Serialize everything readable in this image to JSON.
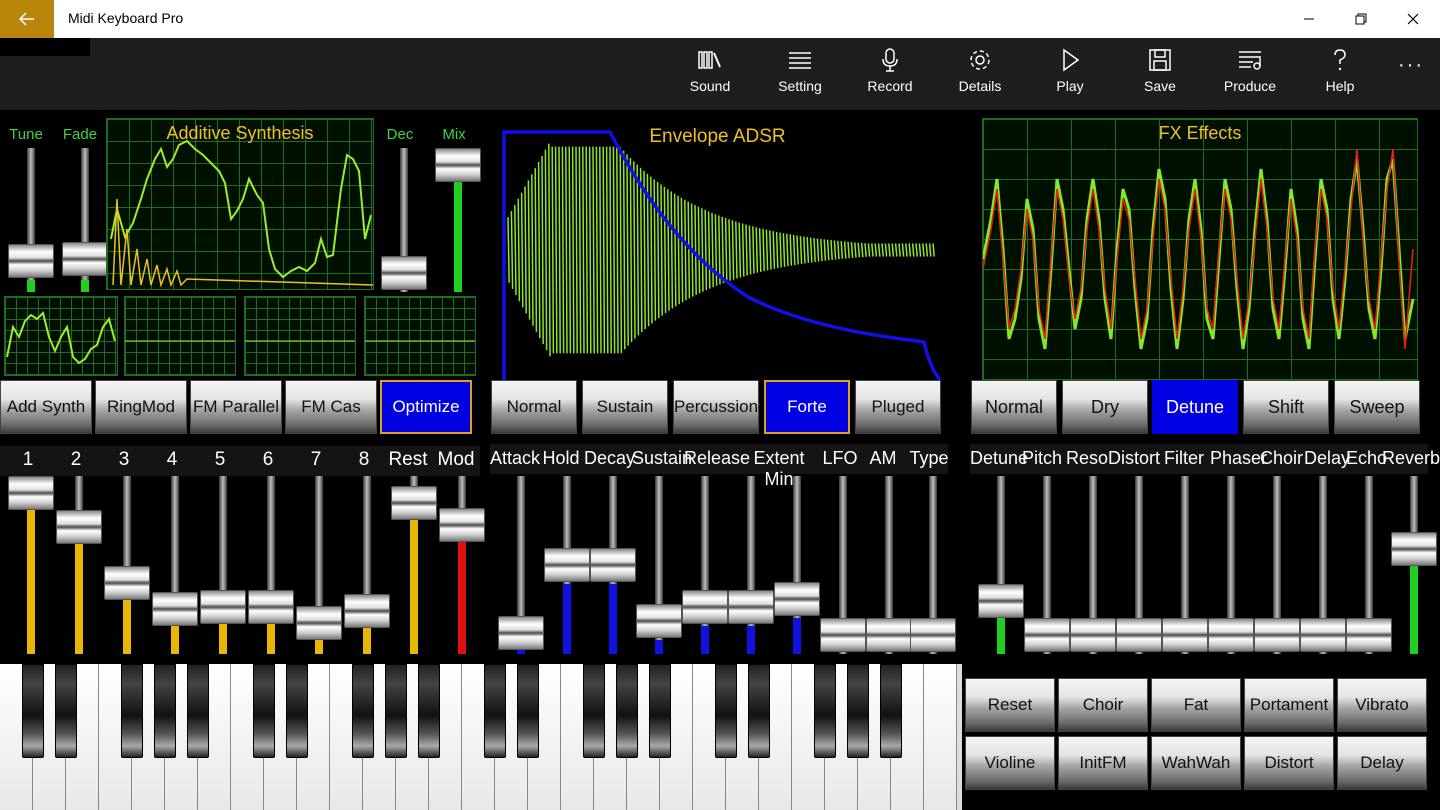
{
  "window": {
    "title": "Midi Keyboard Pro"
  },
  "toolbar": {
    "items": [
      {
        "label": "Sound",
        "icon": "library-icon"
      },
      {
        "label": "Setting",
        "icon": "list-icon"
      },
      {
        "label": "Record",
        "icon": "microphone-icon"
      },
      {
        "label": "Details",
        "icon": "gear-icon"
      },
      {
        "label": "Play",
        "icon": "play-icon"
      },
      {
        "label": "Save",
        "icon": "floppy-icon"
      },
      {
        "label": "Produce",
        "icon": "produce-icon"
      },
      {
        "label": "Help",
        "icon": "question-icon"
      }
    ],
    "more": "···"
  },
  "synthesis": {
    "title": "Additive Synthesis",
    "labels": {
      "tune": "Tune",
      "fade": "Fade",
      "dec": "Dec",
      "mix": "Mix"
    },
    "modes": [
      "Add Synth",
      "RingMod",
      "FM Parallel",
      "FM Cas",
      "Optimize"
    ],
    "selected_mode": "Optimize",
    "slider_labels": [
      "1",
      "2",
      "3",
      "4",
      "5",
      "6",
      "7",
      "8",
      "Rest",
      "Mod"
    ]
  },
  "envelope": {
    "title": "Envelope ADSR",
    "modes": [
      "Normal",
      "Sustain",
      "Percussion",
      "Forte",
      "Pluged"
    ],
    "selected_mode": "Forte",
    "slider_labels": [
      "Attack",
      "Hold",
      "Decay",
      "Sustain",
      "Release",
      "Extent Min",
      "LFO",
      "AM",
      "Type"
    ]
  },
  "fx": {
    "title": "FX Effects",
    "modes": [
      "Normal",
      "Dry",
      "Detune",
      "Shift",
      "Sweep"
    ],
    "selected_mode": "Detune",
    "slider_labels": [
      "Detune",
      "Pitch",
      "Reso",
      "Distort",
      "Filter",
      "Phaser",
      "Choir",
      "Delay",
      "Echo",
      "Reverb"
    ]
  },
  "presets": {
    "row1": [
      "Reset",
      "Choir",
      "Fat",
      "Portament",
      "Vibrato"
    ],
    "row2": [
      "Violine",
      "InitFM",
      "WahWah",
      "Distort",
      "Delay"
    ]
  },
  "colors": {
    "accent_gold": "#e0a020",
    "selected_blue": "#0000e0",
    "scope_green": "#9aee2a",
    "label_green": "#3fd43f",
    "fill_yellow": "#e8b800",
    "fill_red": "#e01010",
    "fill_blue": "#1010e0",
    "fill_green": "#20d020"
  }
}
